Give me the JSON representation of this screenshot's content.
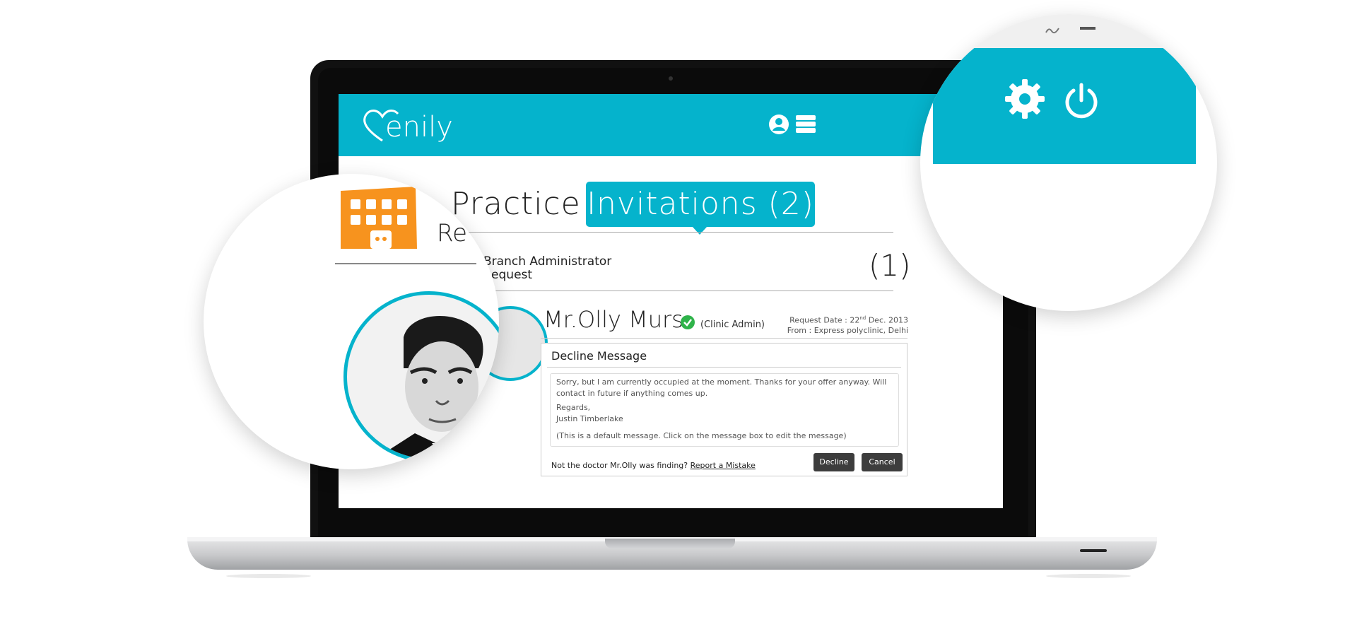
{
  "app": {
    "logo_text": "enily",
    "brand_color": "#05b3cc"
  },
  "header": {
    "icons": [
      "user-icon",
      "server-icon",
      "gear-icon",
      "power-icon"
    ]
  },
  "tabs": {
    "practice_label": "Practice",
    "invitations_label": "Invitations (2)"
  },
  "section": {
    "title_line1": "Branch Administrator",
    "title_line2": "Request",
    "count": "(1)"
  },
  "request": {
    "name": "Mr.Olly Murs",
    "role": "(Clinic Admin)",
    "date_label": "Request Date : 22",
    "date_sup": "nd",
    "date_rest": " Dec. 2013",
    "from": "From : Express polyclinic, Delhi"
  },
  "decline_panel": {
    "title": "Decline Message",
    "message_line1": "Sorry, but I am currently occupied at the moment. Thanks for your offer anyway. Will contact in future if anything comes up.",
    "regards": "Regards,",
    "signature": "Justin Timberlake",
    "hint": "(This is a default message. Click on the message box to edit the message)",
    "not_doctor_text": "Not the doctor Mr.Olly was finding?",
    "report_link": "Report a Mistake",
    "decline_label": "Decline",
    "cancel_label": "Cancel"
  },
  "zoom_left": {
    "partial_text": "Re"
  }
}
